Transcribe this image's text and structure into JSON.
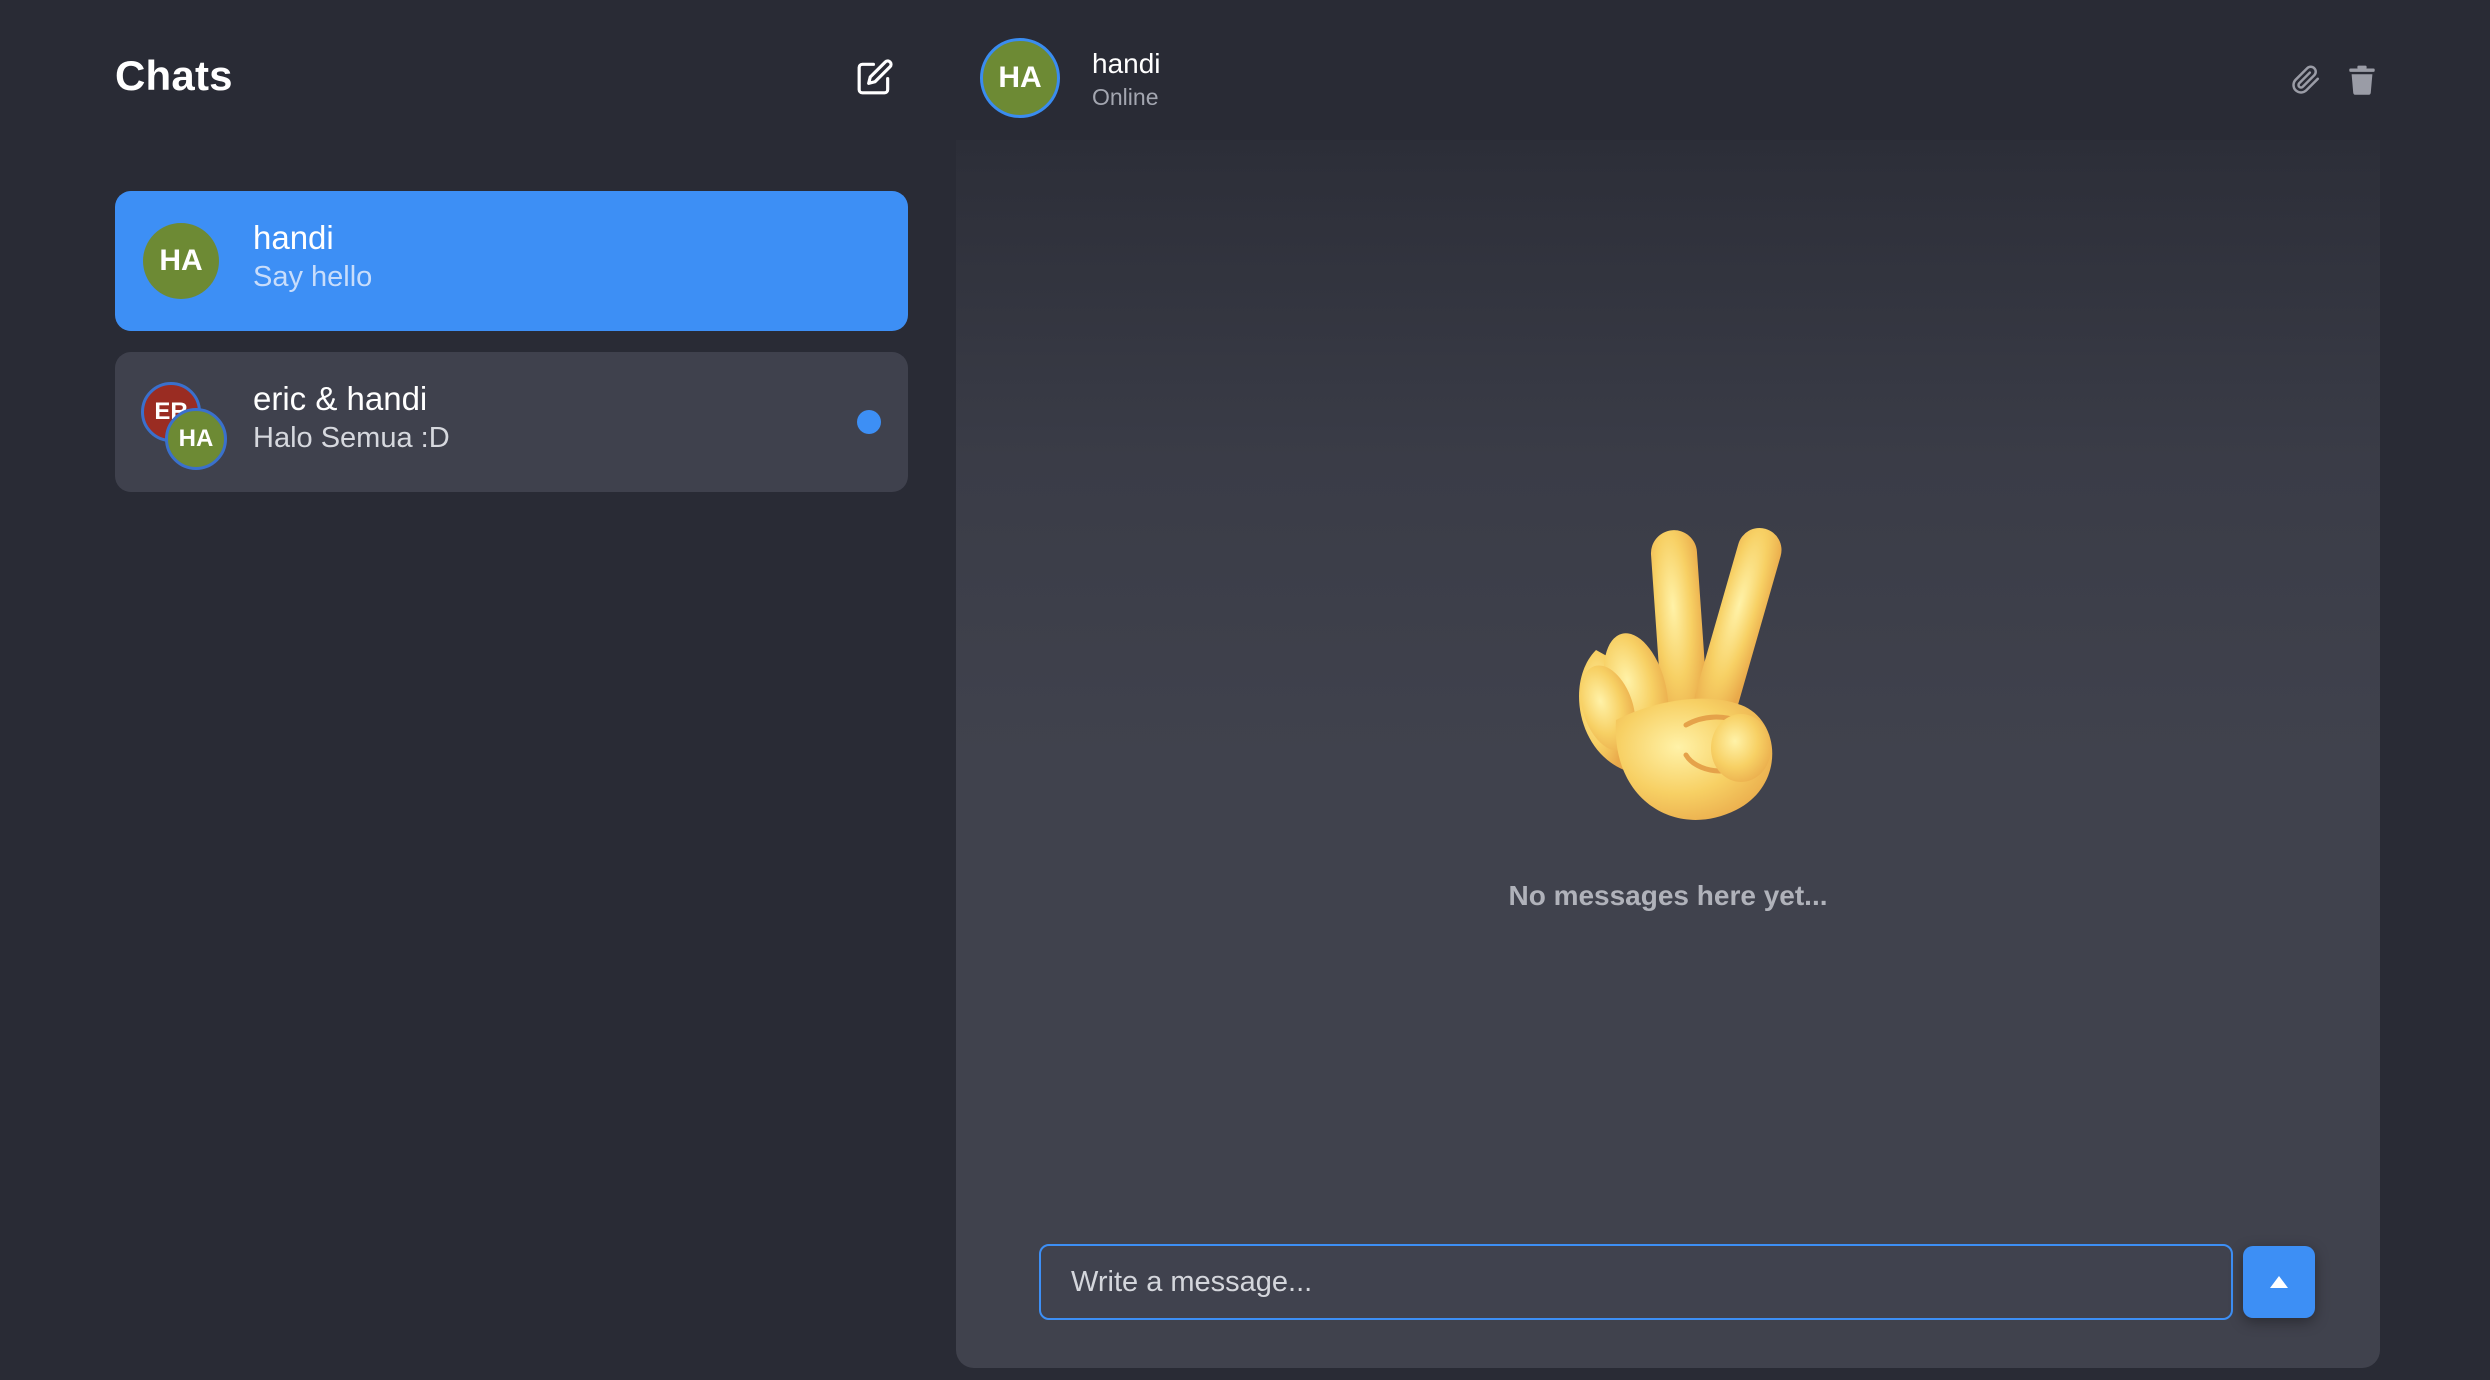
{
  "sidebar": {
    "title": "Chats",
    "new_chat_icon": "edit-icon",
    "chats": [
      {
        "name": "handi",
        "preview": "Say hello",
        "avatar": "HA",
        "active": true,
        "unread": false
      },
      {
        "name": "eric & handi",
        "preview": "Halo Semua :D",
        "avatars": [
          "ER",
          "HA"
        ],
        "active": false,
        "unread": true
      }
    ]
  },
  "header": {
    "avatar": "HA",
    "name": "handi",
    "status": "Online",
    "actions": [
      "paperclip-icon",
      "trash-icon"
    ]
  },
  "conversation": {
    "empty_emoji": "victory-hand-emoji",
    "empty_text": "No messages here yet..."
  },
  "composer": {
    "placeholder": "Write a message...",
    "value": "",
    "send_icon": "triangle-up-icon"
  },
  "colors": {
    "background": "#292b35",
    "accent": "#3d8ff5",
    "avatar_ha": "#6d8a34",
    "avatar_er": "#9a2c22",
    "chat_item": "#3f414d"
  }
}
